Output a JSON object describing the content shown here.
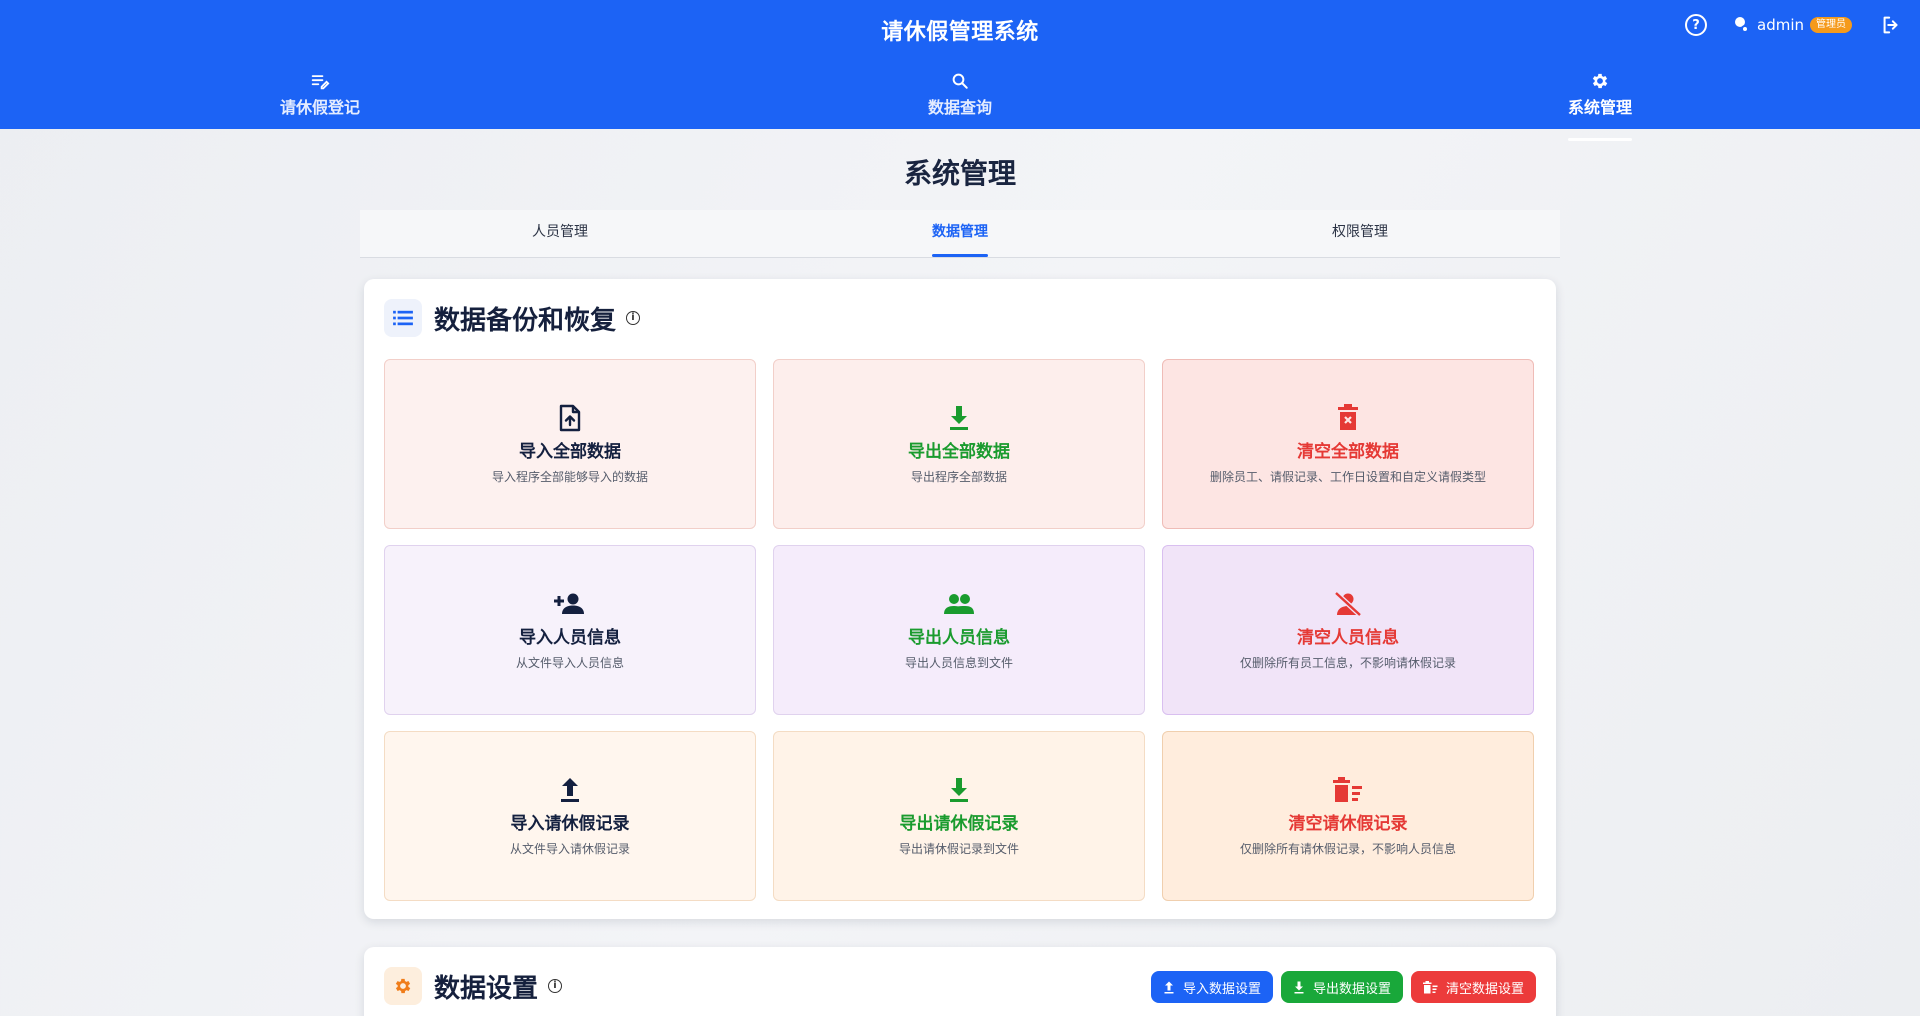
{
  "header": {
    "title": "请休假管理系统",
    "user": "admin",
    "role_badge": "管理员"
  },
  "nav": [
    {
      "label": "请休假登记",
      "icon": "edit-list-icon"
    },
    {
      "label": "数据查询",
      "icon": "search-icon"
    },
    {
      "label": "系统管理",
      "icon": "gear-icon",
      "active": true
    }
  ],
  "page": {
    "title": "系统管理",
    "tabs": [
      "人员管理",
      "数据管理",
      "权限管理"
    ],
    "active_tab": "数据管理"
  },
  "backup": {
    "title": "数据备份和恢复",
    "tiles": [
      {
        "title": "导入全部数据",
        "desc": "导入程序全部能够导入的数据",
        "icon": "file-upload-icon"
      },
      {
        "title": "导出全部数据",
        "desc": "导出程序全部数据",
        "icon": "download-icon"
      },
      {
        "title": "清空全部数据",
        "desc": "删除员工、请假记录、工作日设置和自定义请假类型",
        "icon": "trash-icon"
      },
      {
        "title": "导入人员信息",
        "desc": "从文件导入人员信息",
        "icon": "person-add-icon"
      },
      {
        "title": "导出人员信息",
        "desc": "导出人员信息到文件",
        "icon": "people-icon"
      },
      {
        "title": "清空人员信息",
        "desc": "仅删除所有员工信息，不影响请休假记录",
        "icon": "person-off-icon"
      },
      {
        "title": "导入请休假记录",
        "desc": "从文件导入请休假记录",
        "icon": "upload-icon"
      },
      {
        "title": "导出请休假记录",
        "desc": "导出请休假记录到文件",
        "icon": "download-icon"
      },
      {
        "title": "清空请休假记录",
        "desc": "仅删除所有请休假记录，不影响人员信息",
        "icon": "delete-sweep-icon"
      }
    ]
  },
  "settings": {
    "title": "数据设置",
    "buttons": [
      {
        "label": "导入数据设置",
        "color": "#1c63f5"
      },
      {
        "label": "导出数据设置",
        "color": "#19a83a"
      },
      {
        "label": "清空数据设置",
        "color": "#ec3b3b"
      }
    ]
  },
  "colors": {
    "primary": "#1c63f5",
    "green": "#1a9b2e",
    "red": "#e53935",
    "orange": "#f07d1a"
  }
}
